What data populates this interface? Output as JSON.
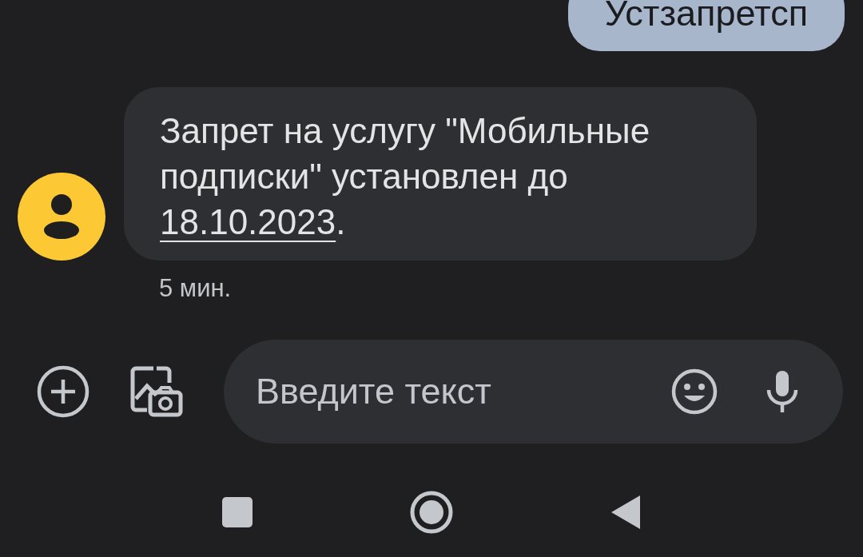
{
  "messages": [
    {
      "kind": "sent",
      "text": "Устзапретсп"
    },
    {
      "kind": "received",
      "text_before": "Запрет на услугу \"Мобильные подписки\" установлен до ",
      "link": "18.10.2023",
      "text_after": ".",
      "time": "5 мин."
    }
  ],
  "composer": {
    "placeholder": "Введите текст"
  }
}
